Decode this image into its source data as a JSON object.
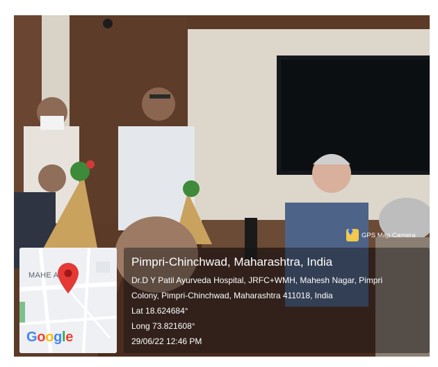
{
  "location": {
    "place": "Pimpri-Chinchwad, Maharashtra, India",
    "address_line1": "Dr.D Y Patil Ayurveda Hospital, JRFC+WMH, Mahesh Nagar, Pimpri",
    "address_line2": "Colony, Pimpri-Chinchwad, Maharashtra 411018, India",
    "lat": "Lat 18.624684°",
    "long": "Long 73.821608°",
    "datetime": "29/06/22 12:46 PM"
  },
  "map": {
    "label": "MAHESH NAGAR",
    "label_visible": "MAHE     AGAR",
    "brand_g": "G",
    "brand_o1": "o",
    "brand_o2": "o",
    "brand_g2": "g",
    "brand_l": "l",
    "brand_e": "e",
    "pin_color": "#e53935"
  },
  "badge": {
    "text": "GPS Map Camera",
    "icon": "map-pin-icon"
  },
  "colors": {
    "wall": "#5a3a28",
    "screen": "#101418",
    "info_bg": "rgba(20,20,22,0.45)"
  }
}
